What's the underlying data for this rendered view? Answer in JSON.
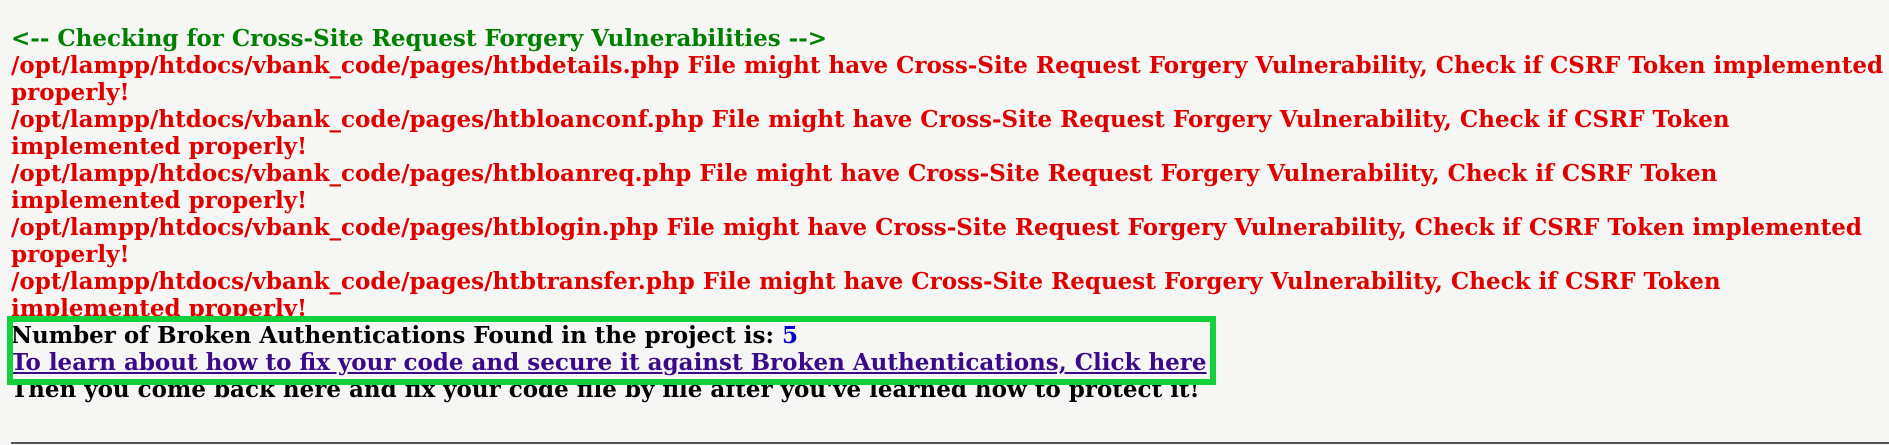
{
  "heading": "<-- Checking for Cross-Site Request Forgery Vulnerabilities -->",
  "vulnerabilities": [
    {
      "path": "/opt/lampp/htdocs/vbank_code/pages/htbdetails.php",
      "message": "File might have Cross-Site Request Forgery Vulnerability, Check if CSRF Token implemented properly!"
    },
    {
      "path": "/opt/lampp/htdocs/vbank_code/pages/htbloanconf.php",
      "message": "File might have Cross-Site Request Forgery Vulnerability, Check if CSRF Token implemented properly!"
    },
    {
      "path": "/opt/lampp/htdocs/vbank_code/pages/htbloanreq.php",
      "message": "File might have Cross-Site Request Forgery Vulnerability, Check if CSRF Token implemented properly!"
    },
    {
      "path": "/opt/lampp/htdocs/vbank_code/pages/htblogin.php",
      "message": "File might have Cross-Site Request Forgery Vulnerability, Check if CSRF Token implemented properly!"
    },
    {
      "path": "/opt/lampp/htdocs/vbank_code/pages/htbtransfer.php",
      "message": "File might have Cross-Site Request Forgery Vulnerability, Check if CSRF Token implemented properly!"
    }
  ],
  "summary": {
    "label": "Number of Broken Authentications Found in the project is:",
    "count": "5"
  },
  "help_link": "To learn about how to fix your code and secure it against Broken Authentications, Click here",
  "followup": "Then you come back here and fix your code file by file after you've learned how to protect it!",
  "colors": {
    "heading": "#008000",
    "vulnerability": "#e00000",
    "count": "#0000d0",
    "link": "#3b0a8a",
    "highlight": "#13d13a"
  }
}
